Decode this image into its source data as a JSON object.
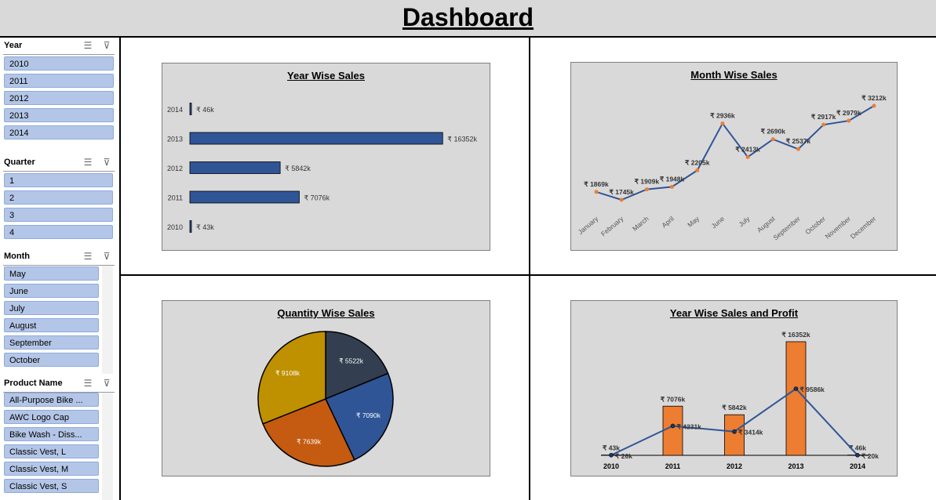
{
  "title": "Dashboard",
  "slicers": {
    "year": {
      "title": "Year",
      "items": [
        "2010",
        "2011",
        "2012",
        "2013",
        "2014"
      ]
    },
    "quarter": {
      "title": "Quarter",
      "items": [
        "1",
        "2",
        "3",
        "4"
      ]
    },
    "month": {
      "title": "Month",
      "items": [
        "May",
        "June",
        "July",
        "August",
        "September",
        "October"
      ]
    },
    "product": {
      "title": "Product Name",
      "items": [
        "All-Purpose Bike ...",
        "AWC Logo Cap",
        "Bike Wash - Diss...",
        "Classic Vest, L",
        "Classic Vest, M",
        "Classic Vest, S"
      ]
    }
  },
  "icons": {
    "multiselect": "multi-select-icon",
    "clearfilter": "clear-filter-icon"
  },
  "colors": {
    "bar_blue": "#2f5597",
    "line_blue": "#2f5597",
    "marker_orange": "#ed7d31",
    "col_orange": "#ed7d31",
    "pie": [
      "#333f50",
      "#2f5597",
      "#c55a11",
      "#bf9000"
    ]
  },
  "chart_data": [
    {
      "type": "bar",
      "title": "Year Wise Sales",
      "categories": [
        "2014",
        "2013",
        "2012",
        "2011",
        "2010"
      ],
      "values": [
        46,
        16352,
        5842,
        7076,
        43
      ],
      "labels": [
        "₹ 46k",
        "₹ 16352k",
        "₹ 5842k",
        "₹ 7076k",
        "₹ 43k"
      ],
      "xlim": [
        0,
        17000
      ]
    },
    {
      "type": "line",
      "title": "Month Wise Sales",
      "categories": [
        "January",
        "February",
        "March",
        "April",
        "May",
        "June",
        "July",
        "August",
        "September",
        "October",
        "November",
        "December"
      ],
      "values": [
        1869,
        1745,
        1909,
        1948,
        2205,
        2936,
        2413,
        2690,
        2537,
        2917,
        2979,
        3212
      ],
      "labels": [
        "₹ 1869k",
        "₹ 1745k",
        "₹ 1909k",
        "₹ 1948k",
        "₹ 2205k",
        "₹ 2936k",
        "₹ 2413k",
        "₹ 2690k",
        "₹ 2537k",
        "₹ 2917k",
        "₹ 2979k",
        "₹ 3212k"
      ]
    },
    {
      "type": "pie",
      "title": "Quantity Wise Sales",
      "values": [
        5522,
        7090,
        7639,
        9108
      ],
      "labels": [
        "₹ 5522k",
        "₹ 7090k",
        "₹ 7639k",
        "₹ 9108k"
      ]
    },
    {
      "type": "bar",
      "title": "Year Wise Sales and Profit",
      "categories": [
        "2010",
        "2011",
        "2012",
        "2013",
        "2014"
      ],
      "series": [
        {
          "type": "bar",
          "values": [
            43,
            7076,
            5842,
            16352,
            46
          ],
          "labels": [
            "₹ 43k",
            "₹ 7076k",
            "₹ 5842k",
            "₹ 16352k",
            "₹ 46k"
          ]
        },
        {
          "type": "line",
          "values": [
            26,
            4231,
            3414,
            9586,
            20
          ],
          "labels": [
            "₹ 26k",
            "₹ 4231k",
            "₹ 3414k",
            "₹ 9586k",
            "₹ 20k"
          ]
        }
      ],
      "ylim": [
        0,
        16352
      ]
    }
  ]
}
